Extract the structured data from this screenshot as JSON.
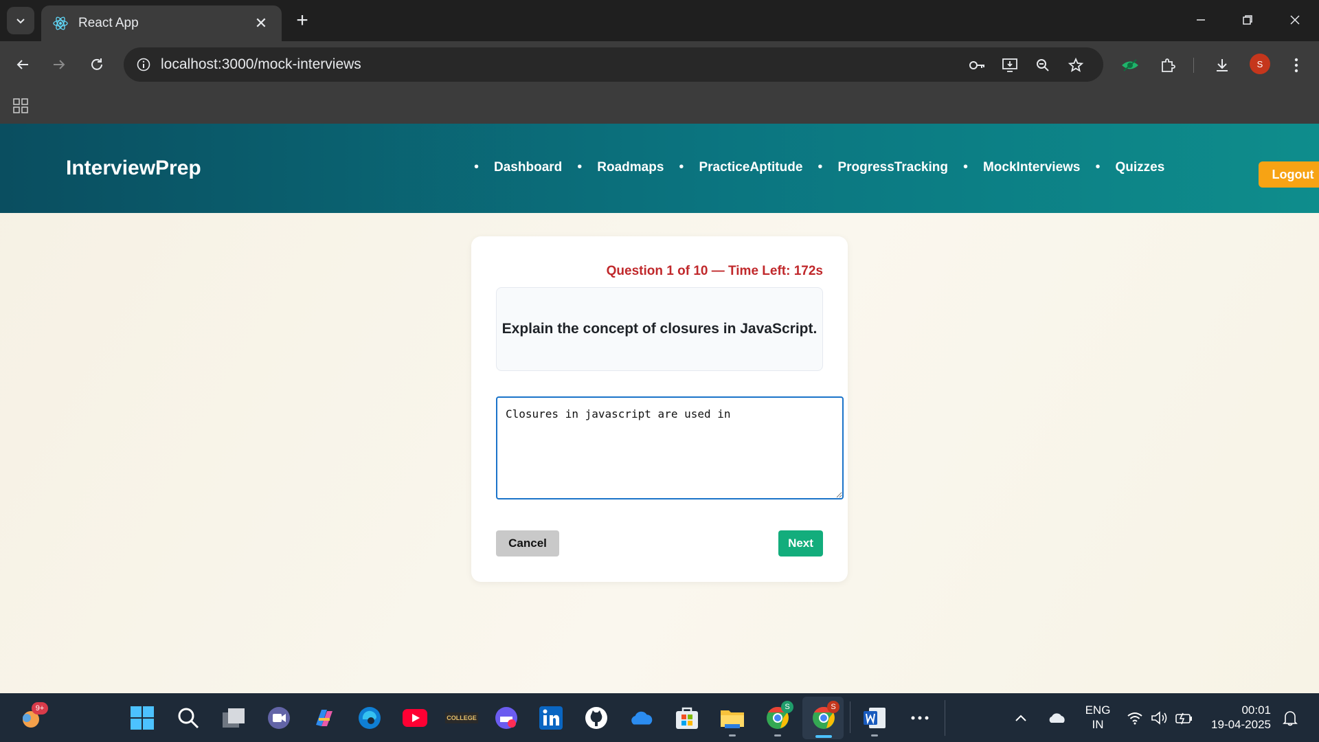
{
  "browser": {
    "tab_title": "React App",
    "url": "localhost:3000/mock-interviews",
    "profile_initial": "S"
  },
  "app": {
    "brand": "InterviewPrep",
    "nav": [
      "Dashboard",
      "Roadmaps",
      "PracticeAptitude",
      "ProgressTracking",
      "MockInterviews",
      "Quizzes"
    ],
    "logout_label": "Logout"
  },
  "interview": {
    "status": "Question 1 of 10 — Time Left: 172s",
    "question": "Explain the concept of closures in JavaScript.",
    "answer": "Closures in javascript are used in ",
    "cancel_label": "Cancel",
    "next_label": "Next"
  },
  "taskbar": {
    "widget_badge": "9+",
    "chrome_badge_1": "S",
    "chrome_badge_2": "S",
    "lang_top": "ENG",
    "lang_bottom": "IN",
    "time": "00:01",
    "date": "19-04-2025",
    "college_label": "COLLEGE"
  },
  "colors": {
    "navbar_start": "#0a4e60",
    "navbar_end": "#0e8d8c",
    "logout": "#f7a314",
    "next": "#13ad7c",
    "status": "#c0282b",
    "focus": "#1a73c9"
  }
}
